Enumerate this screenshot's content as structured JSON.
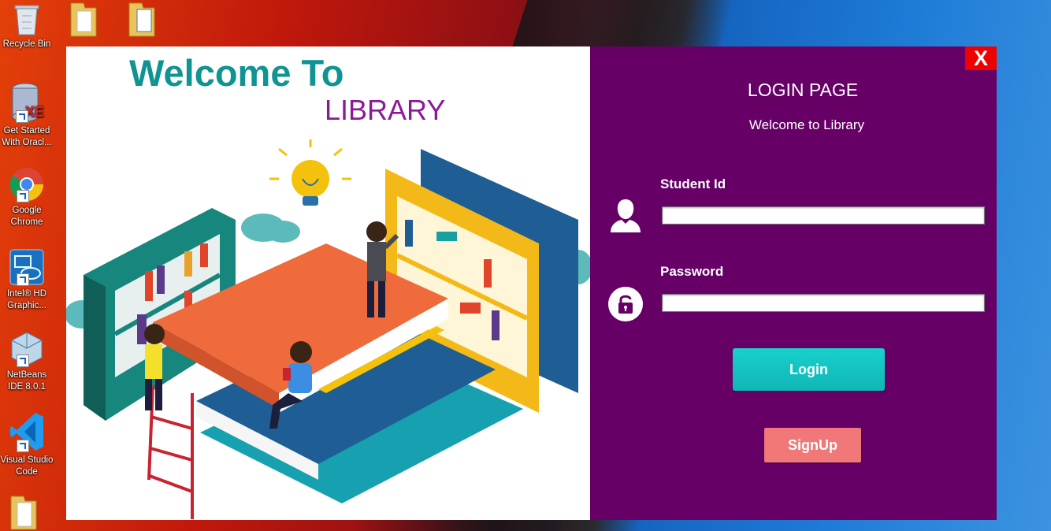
{
  "desktop": {
    "icons": [
      {
        "label": "Recycle Bin"
      },
      {
        "label": "Get Started With Oracl..."
      },
      {
        "label": "Google Chrome"
      },
      {
        "label": "Intel® HD Graphic..."
      },
      {
        "label": "NetBeans IDE 8.0.1"
      },
      {
        "label": "Visual Studio Code"
      }
    ]
  },
  "left": {
    "title": "Welcome To",
    "subtitle": "LIBRARY"
  },
  "right": {
    "close_label": "X",
    "title": "LOGIN PAGE",
    "welcome": "Welcome to Library",
    "student_id_label": "Student Id",
    "student_id_value": "",
    "password_label": "Password",
    "password_value": "",
    "login_label": "Login",
    "signup_label": "SignUp"
  },
  "colors": {
    "panel": "#660066",
    "title_teal": "#0f9493",
    "library_purple": "#8a1a96",
    "login_button": "#19d0cc",
    "signup_button": "#f07878",
    "close_button": "#ee0000"
  }
}
